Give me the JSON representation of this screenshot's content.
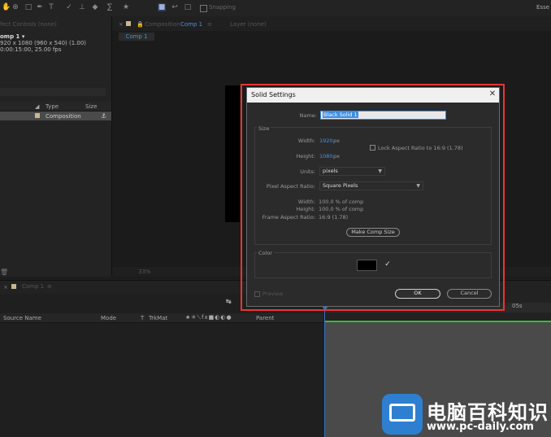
{
  "toolbar": {
    "snapping_label": "Snapping",
    "essentials_label": "Esse"
  },
  "project_panel": {
    "effect_controls_tab": "fect Controls (none)",
    "comp_name": "omp 1 ▾",
    "comp_info": "920 x 1080 (960 x 540) (1.00)",
    "comp_duration": "0:00:15:00, 25.00 fps",
    "columns": {
      "type": "Type",
      "size": "Size"
    },
    "row": {
      "type": "Composition"
    }
  },
  "composition_panel": {
    "tab_label": "Composition",
    "tab_comp": "Comp 1",
    "layer_tab": "Layer (none)",
    "subtab": "Comp 1",
    "zoom": "33%"
  },
  "timeline": {
    "tab_label": "Comp 1",
    "columns": {
      "source_name": "Source Name",
      "mode": "Mode",
      "t": "T",
      "trkmat": "TrkMat",
      "parent": "Parent"
    },
    "ruler_label": "05s"
  },
  "dialog": {
    "title": "Solid Settings",
    "name_label": "Name:",
    "name_value": "Black Solid 1",
    "size_group": "Size",
    "width_label": "Width:",
    "width_value": "1920",
    "width_unit": "px",
    "height_label": "Height:",
    "height_value": "1080",
    "height_unit": "px",
    "lock_aspect": "Lock Aspect Ratio to 16:9 (1.78)",
    "units_label": "Units:",
    "units_value": "pixels",
    "par_label": "Pixel Aspect Ratio:",
    "par_value": "Square Pixels",
    "pct_width_label": "Width:",
    "pct_width_value": "100.0 % of comp",
    "pct_height_label": "Height:",
    "pct_height_value": "100.0 % of comp",
    "frame_aspect_label": "Frame Aspect Ratio:",
    "frame_aspect_value": "16:9 (1.78)",
    "make_comp_size": "Make Comp Size",
    "color_group": "Color",
    "color_value": "#000000",
    "preview_label": "Preview",
    "ok_label": "OK",
    "cancel_label": "Cancel"
  },
  "watermark": {
    "title": "电脑百科知识",
    "url": "www.pc-daily.com"
  },
  "colors": {
    "accent": "#3e8de0",
    "highlight": "#e33333",
    "timeline_green": "#2fbf2f"
  }
}
